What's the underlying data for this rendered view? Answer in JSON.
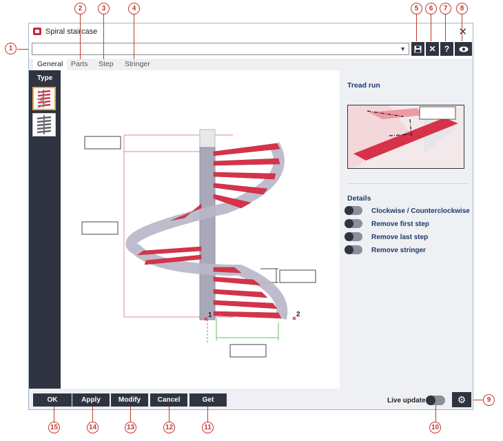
{
  "window": {
    "title": "Spiral staircase",
    "close_glyph": "✕"
  },
  "combo": {
    "value": "",
    "arrow": "▼"
  },
  "toolbar": {
    "save_glyph": "▀",
    "delete_glyph": "✕",
    "help_glyph": "?",
    "view_glyph": "◉"
  },
  "tabs": [
    {
      "label": "General",
      "active": true
    },
    {
      "label": "Parts"
    },
    {
      "label": "Step"
    },
    {
      "label": "Stringer"
    }
  ],
  "sidebar": {
    "label": "Type"
  },
  "canvas": {
    "point1": "1",
    "point2": "2"
  },
  "right_panel": {
    "tread_run_title": "Tread run",
    "details_title": "Details",
    "options": [
      "Clockwise / Counterclockwise",
      "Remove first step",
      "Remove last step",
      "Remove stringer"
    ]
  },
  "footer": {
    "buttons": [
      "OK",
      "Apply",
      "Modify",
      "Cancel",
      "Get"
    ],
    "live_update_label": "Live update",
    "gear_glyph": "⚙"
  },
  "callouts": [
    "1",
    "2",
    "3",
    "4",
    "5",
    "6",
    "7",
    "8",
    "9",
    "10",
    "11",
    "12",
    "13",
    "14",
    "15"
  ],
  "colors": {
    "accent_red": "#c0392b",
    "dark_panel": "#2f3440",
    "stair_red": "#d6334a",
    "label_blue": "#1e3a6a"
  }
}
